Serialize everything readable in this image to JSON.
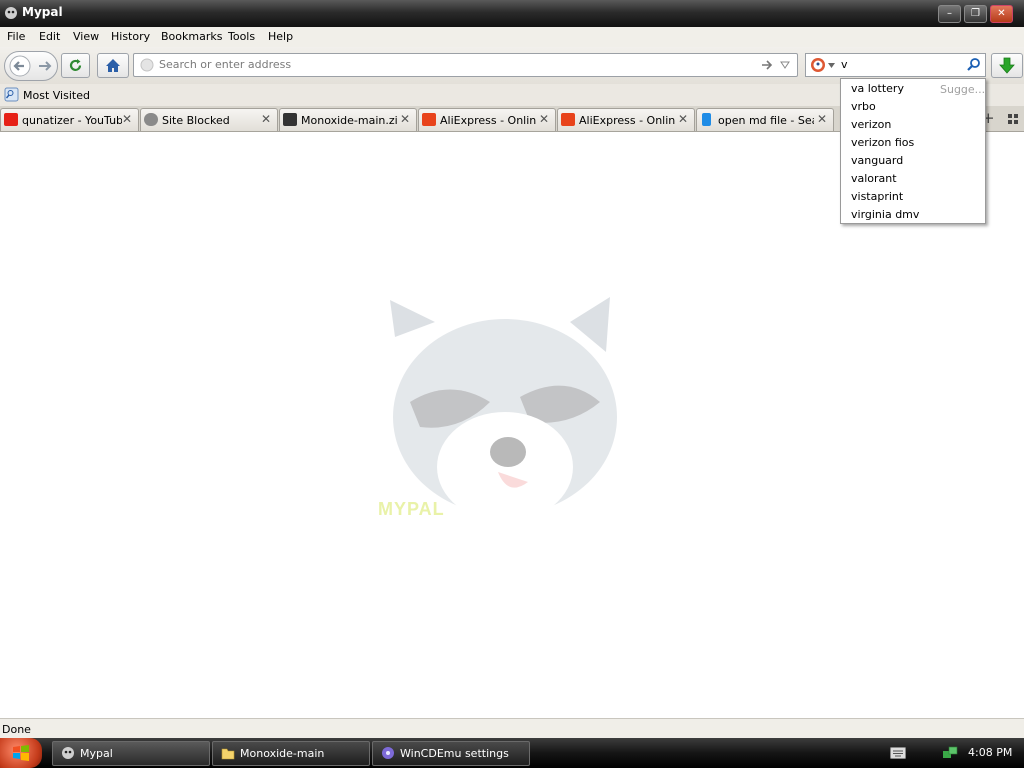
{
  "window": {
    "title": "Mypal"
  },
  "menu": [
    "File",
    "Edit",
    "View",
    "History",
    "Bookmarks",
    "Tools",
    "Help"
  ],
  "navbar": {
    "url_placeholder": "Search or enter address",
    "search_value": "v"
  },
  "bookmarks": {
    "most_visited": "Most Visited"
  },
  "tabs": [
    {
      "label": "qunatizer - YouTube",
      "icon": "youtube-icon",
      "color": "#e62117"
    },
    {
      "label": "Site Blocked",
      "icon": "globe-icon",
      "color": "#8a8a8a"
    },
    {
      "label": "Monoxide-main.zi...",
      "icon": "github-icon",
      "color": "#333333"
    },
    {
      "label": "AliExpress - Onlin...",
      "icon": "aliexpress-icon",
      "color": "#e8431b"
    },
    {
      "label": "AliExpress - Onlin...",
      "icon": "aliexpress-icon",
      "color": "#e8431b"
    },
    {
      "label": "open md file - Sea...",
      "icon": "bing-icon",
      "color": "#1f8ce6"
    }
  ],
  "suggestions": {
    "header": "Sugge...",
    "items": [
      "va lottery",
      "vrbo",
      "verizon",
      "verizon fios",
      "vanguard",
      "valorant",
      "vistaprint",
      "virginia dmv"
    ]
  },
  "content": {
    "logo_text": "MYPAL"
  },
  "status": {
    "text": "Done"
  },
  "taskbar": {
    "items": [
      {
        "label": "Mypal"
      },
      {
        "label": "Monoxide-main"
      },
      {
        "label": "WinCDEmu settings"
      }
    ],
    "clock": "4:08 PM"
  },
  "colors": {
    "download_green": "#2aa52a",
    "link_blue": "#1a5fb4"
  }
}
